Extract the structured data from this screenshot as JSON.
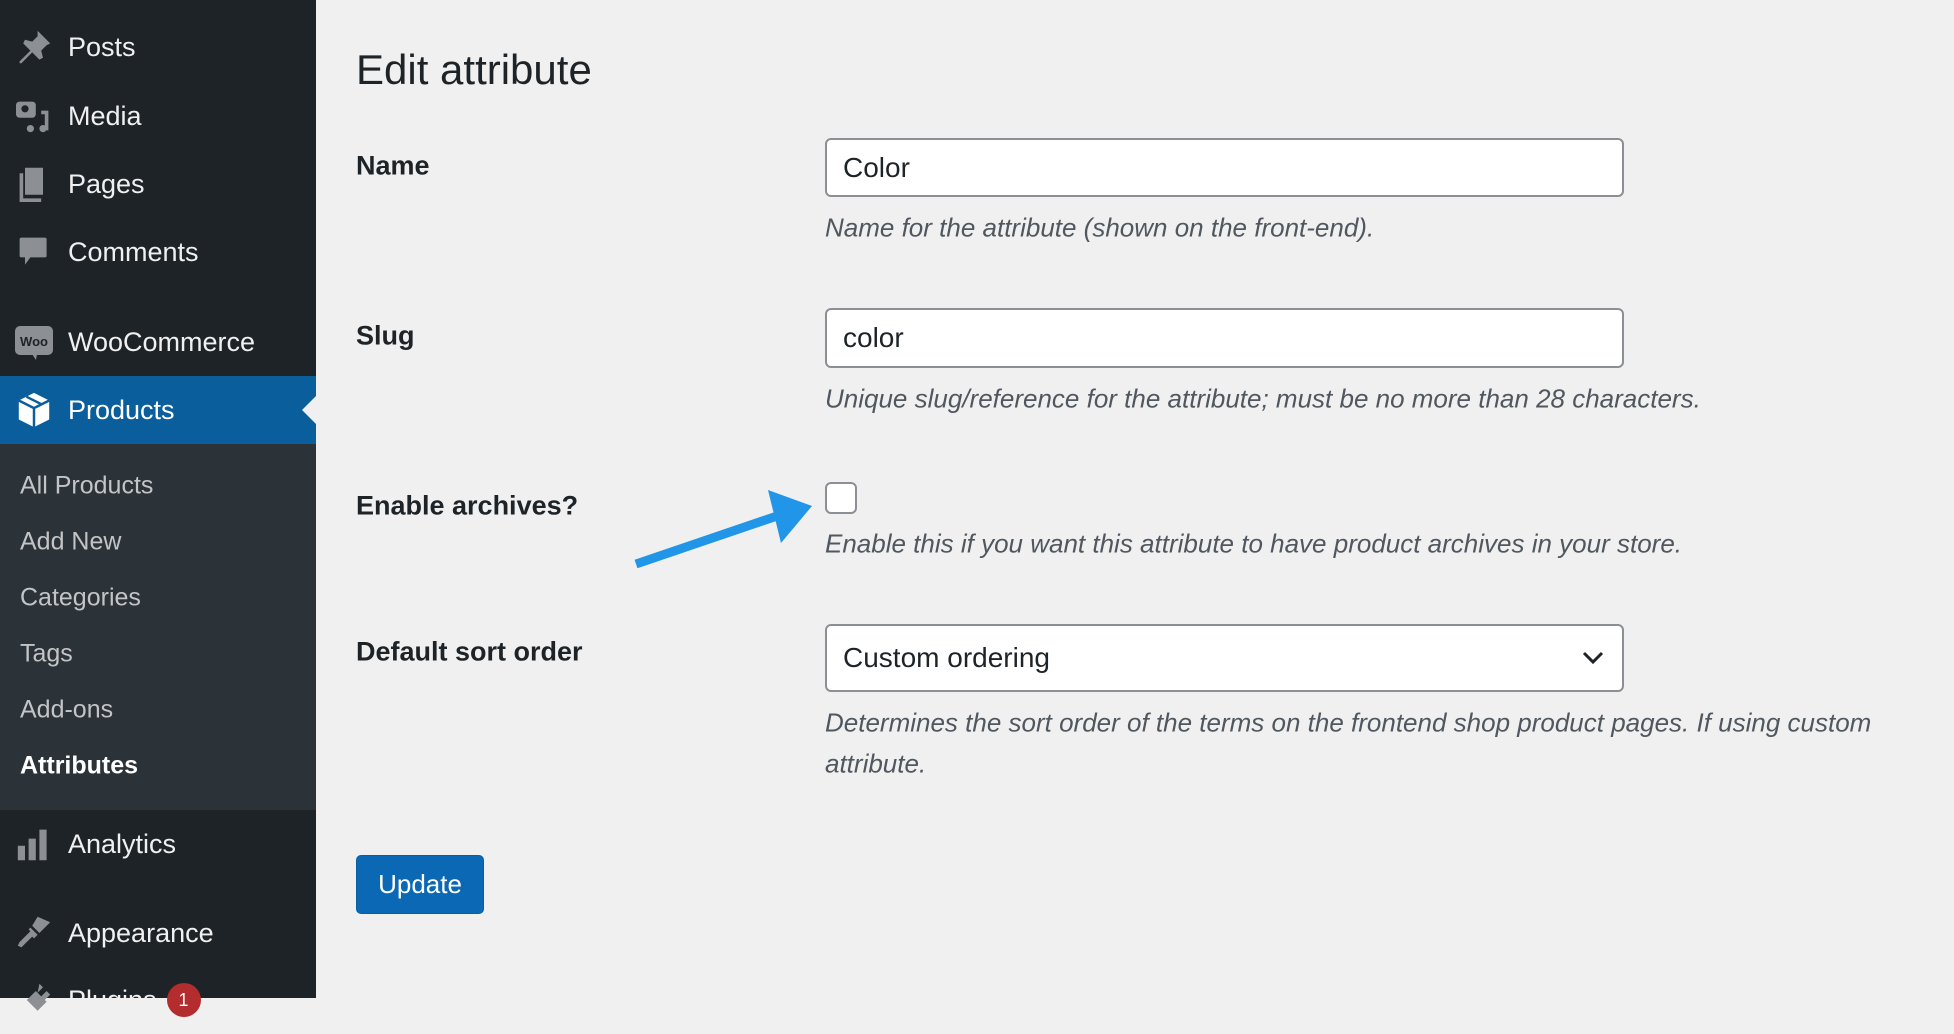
{
  "sidebar": {
    "items": [
      {
        "label": "Posts",
        "icon": "pushpin-icon"
      },
      {
        "label": "Media",
        "icon": "media-icon"
      },
      {
        "label": "Pages",
        "icon": "pages-icon"
      },
      {
        "label": "Comments",
        "icon": "comment-icon"
      },
      {
        "label": "WooCommerce",
        "icon": "woo-icon"
      },
      {
        "label": "Products",
        "icon": "box-icon"
      },
      {
        "label": "Analytics",
        "icon": "bar-chart-icon"
      },
      {
        "label": "Appearance",
        "icon": "paintbrush-icon"
      },
      {
        "label": "Plugins",
        "icon": "plugin-icon",
        "badge": "1"
      }
    ],
    "submenu": [
      "All Products",
      "Add New",
      "Categories",
      "Tags",
      "Add-ons",
      "Attributes"
    ],
    "active_color": "#0a5e9b"
  },
  "main": {
    "title": "Edit attribute",
    "name": {
      "label": "Name",
      "value": "Color",
      "description": "Name for the attribute (shown on the front-end)."
    },
    "slug": {
      "label": "Slug",
      "value": "color",
      "description": "Unique slug/reference for the attribute; must be no more than 28 characters."
    },
    "archives": {
      "label": "Enable archives?",
      "checked": false,
      "description": "Enable this if you want this attribute to have product archives in your store."
    },
    "sort": {
      "label": "Default sort order",
      "value": "Custom ordering",
      "description_line1": "Determines the sort order of the terms on the frontend shop product pages. If using custom",
      "description_line2": "attribute."
    },
    "update_label": "Update",
    "arrow_color": "#2196e8"
  }
}
